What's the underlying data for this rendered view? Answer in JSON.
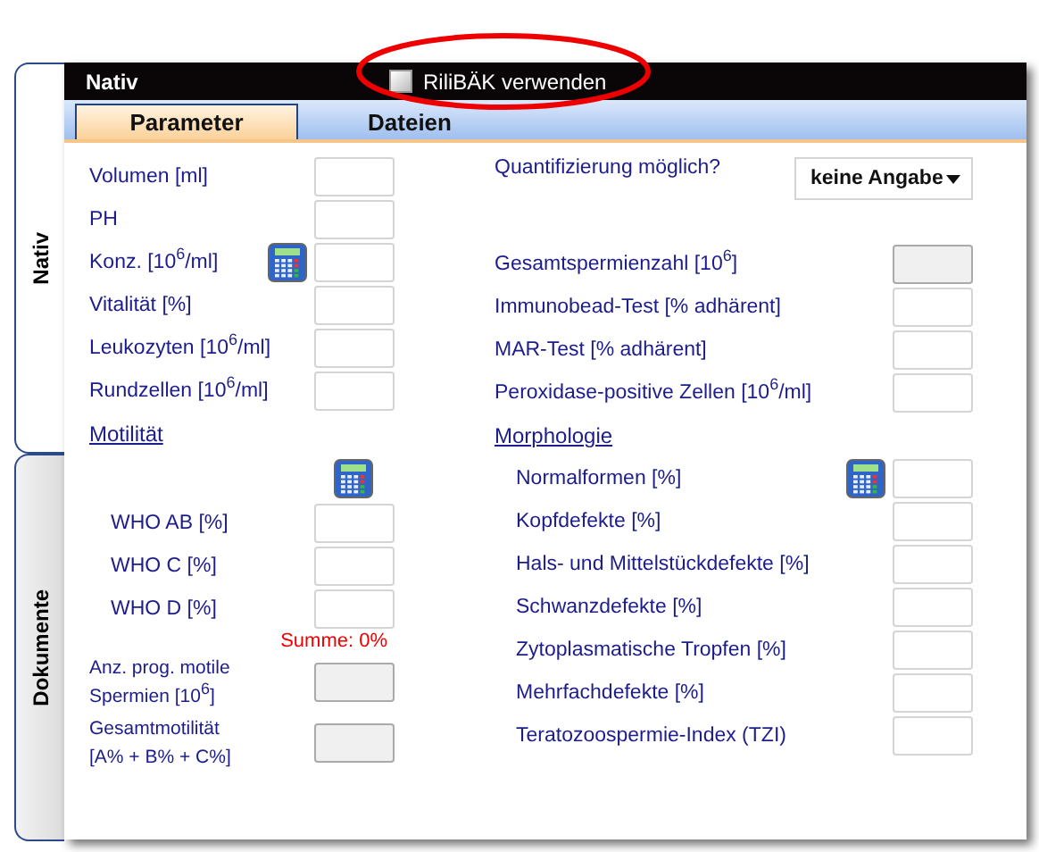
{
  "side_tabs": [
    {
      "label": "Nativ",
      "selected": true
    },
    {
      "label": "Dokumente",
      "selected": false
    }
  ],
  "header": {
    "title": "Nativ",
    "checkbox": {
      "label": "RiliBÄK verwenden",
      "checked": false,
      "highlighted": true
    }
  },
  "tabs": [
    {
      "label": "Parameter",
      "selected": true
    },
    {
      "label": "Dateien",
      "selected": false
    }
  ],
  "left_rows": [
    {
      "kind": "field",
      "label": "Volumen [ml]",
      "readonly": false
    },
    {
      "kind": "field",
      "label": "PH",
      "readonly": false
    },
    {
      "kind": "field",
      "label": "Konz. [10$^{6}$/ml]",
      "readonly": false,
      "calculator": true
    },
    {
      "kind": "field",
      "label": "Vitalität [%]",
      "readonly": false
    },
    {
      "kind": "field",
      "label": "Leukozyten [10$^{6}$/ml]",
      "readonly": false
    },
    {
      "kind": "field",
      "label": "Rundzellen [10$^{6}$/ml]",
      "readonly": false
    },
    {
      "kind": "heading",
      "label": "Motilität"
    },
    {
      "kind": "calculator"
    },
    {
      "kind": "subfield",
      "label": "WHO AB [%]",
      "readonly": false
    },
    {
      "kind": "subfield",
      "label": "WHO C [%]",
      "readonly": false
    },
    {
      "kind": "subfield",
      "label": "WHO D [%]",
      "readonly": false
    },
    {
      "kind": "sum",
      "label": "Summe: 0%"
    },
    {
      "kind": "field2",
      "label": "Anz. prog. motile Spermien [10$^{6}$]",
      "readonly": true
    },
    {
      "kind": "field2",
      "label": "Gesamtmotilität [A% + B% + C%]",
      "readonly": true
    }
  ],
  "right_rows": [
    {
      "kind": "select",
      "label": "Quantifizierung möglich?",
      "value": "keine Angabe"
    },
    {
      "kind": "field",
      "label": "Gesamtspermienzahl [10$^{6}$]",
      "readonly": true
    },
    {
      "kind": "field",
      "label": "Immunobead-Test [% adhärent]",
      "readonly": false
    },
    {
      "kind": "field",
      "label": "MAR-Test [% adhärent]",
      "readonly": false
    },
    {
      "kind": "field",
      "label": "Peroxidase-positive Zellen [10$^{6}$/ml]",
      "readonly": false
    },
    {
      "kind": "heading",
      "label": "Morphologie"
    },
    {
      "kind": "subfield",
      "label": "Normalformen [%]",
      "readonly": false,
      "calculator": true
    },
    {
      "kind": "subfield",
      "label": "Kopfdefekte [%]",
      "readonly": false
    },
    {
      "kind": "subfield",
      "label": "Hals- und Mittelstückdefekte [%]",
      "readonly": false
    },
    {
      "kind": "subfield",
      "label": "Schwanzdefekte [%]",
      "readonly": false
    },
    {
      "kind": "subfield",
      "label": "Zytoplasmatische Tropfen [%]",
      "readonly": false
    },
    {
      "kind": "subfield",
      "label": "Mehrfachdefekte [%]",
      "readonly": false
    },
    {
      "kind": "subfield",
      "label": "Teratozoospermie-Index (TZI)",
      "readonly": false
    }
  ]
}
